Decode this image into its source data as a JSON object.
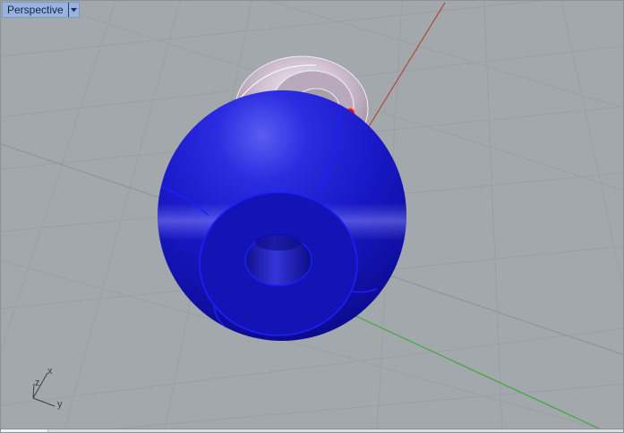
{
  "viewport": {
    "title": "Perspective",
    "background_color": "#a3a8ac",
    "title_tab_color": "#98b4de",
    "menu_icon": "dropdown-arrow-icon"
  },
  "axes_gizmo": {
    "x_label": "x",
    "y_label": "y",
    "z_label": "z"
  },
  "world_axes": {
    "x_axis_color": "#b3483f",
    "y_axis_color": "#3fa83a"
  },
  "objects": {
    "sphere_color": "#1c1ccb",
    "sphere_edge_color": "#1e1eff",
    "torus_color": "#c6b6c8",
    "point_color": "#e01010"
  }
}
